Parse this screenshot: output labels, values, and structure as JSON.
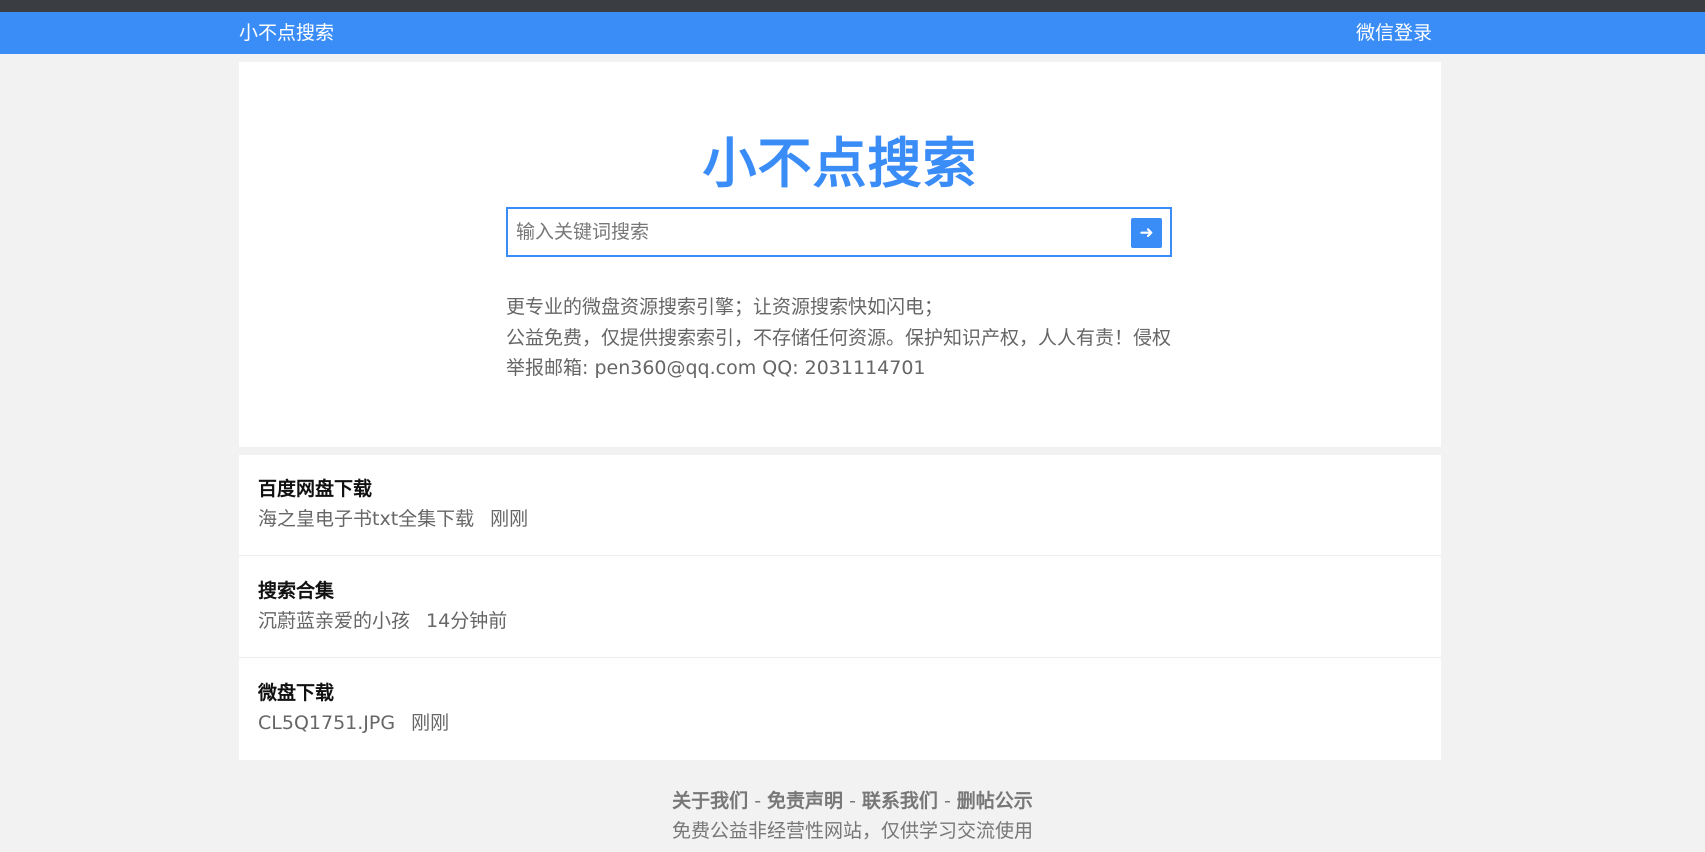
{
  "navbar": {
    "brand": "小不点搜索",
    "login": "微信登录"
  },
  "hero": {
    "title": "小不点搜索",
    "search_placeholder": "输入关键词搜索",
    "search_button_icon": "arrow-right-icon",
    "desc_line1": "更专业的微盘资源搜索引擎；让资源搜索快如闪电；",
    "desc_line2": "公益免费，仅提供搜索索引，不存储任何资源。保护知识产权，人人有责！侵权举报邮箱: pen360@qq.com QQ: 2031114701"
  },
  "list": {
    "items": [
      {
        "title": "百度网盘下载",
        "name": "海之皇电子书txt全集下载",
        "time": "刚刚"
      },
      {
        "title": "搜索合集",
        "name": "沉蔚蓝亲爱的小孩",
        "time": "14分钟前"
      },
      {
        "title": "微盘下载",
        "name": "CL5Q1751.JPG",
        "time": "刚刚"
      }
    ]
  },
  "footer": {
    "links": [
      "关于我们",
      "免责声明",
      "联系我们",
      "删帖公示"
    ],
    "separator": "-",
    "note": "免费公益非经营性网站，仅供学习交流使用"
  },
  "colors": {
    "accent": "#3a8cf7",
    "background": "#f2f2f2"
  }
}
